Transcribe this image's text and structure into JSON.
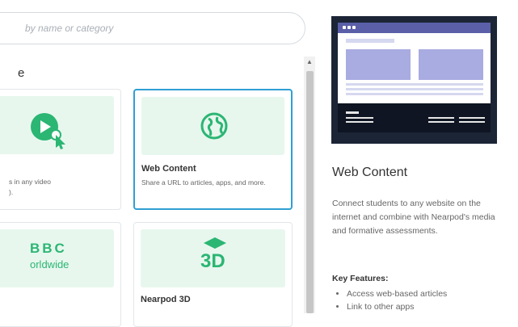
{
  "search": {
    "placeholder": "by name or category"
  },
  "section": {
    "heading": "e"
  },
  "cards": [
    {
      "title": "",
      "desc": "s in any video\n)."
    },
    {
      "title": "Web Content",
      "desc": "Share a URL to articles, apps, and more."
    },
    {
      "title": "",
      "desc": "",
      "logo_text": "BBC",
      "logo_sub": "orldwide"
    },
    {
      "title": "Nearpod 3D",
      "desc": "",
      "logo_text": "3D"
    }
  ],
  "detail": {
    "title": "Web Content",
    "description": "Connect students to any website on the internet and combine with Nearpod's media and formative assessments.",
    "features_heading": "Key Features:",
    "features": [
      "Access web-based articles",
      "Link to other apps"
    ]
  },
  "colors": {
    "accent": "#2f9fd3",
    "brand_green": "#2bb673",
    "thumb_bg": "#e7f7ee",
    "preview_frame": "#1b2536",
    "preview_purple": "#5b5fa8"
  }
}
